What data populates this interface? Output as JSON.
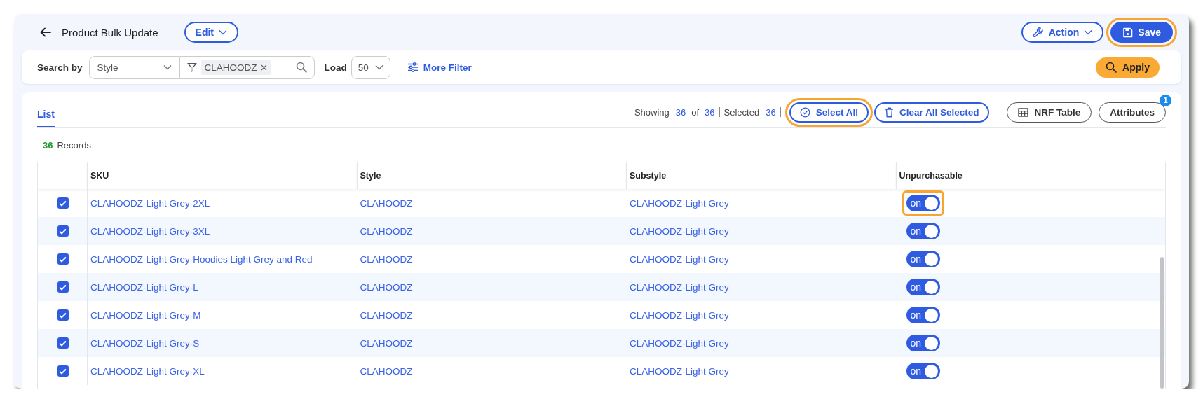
{
  "header": {
    "title": "Product Bulk Update",
    "edit_button": "Edit",
    "action_button": "Action",
    "save_button": {
      "label": "Save",
      "highlighted": true
    }
  },
  "filter_bar": {
    "search_by_label": "Search by",
    "search_by_value": "Style",
    "filter_chip": "CLAHOODZ",
    "load_label": "Load",
    "load_value": "50",
    "more_filter": "More Filter",
    "apply_button": "Apply"
  },
  "list": {
    "tabs": [
      {
        "label": "List",
        "selected": true
      }
    ],
    "records_count": "36",
    "records_label": "Records",
    "summary": {
      "showing_label": "Showing",
      "showing": "36",
      "of_label": "of",
      "total": "36",
      "selected_label": "Selected",
      "selected": "36"
    },
    "select_all": {
      "label": "Select All",
      "highlighted": true
    },
    "clear_all": "Clear All Selected",
    "nrf_table": "NRF Table",
    "attributes": {
      "label": "Attributes",
      "badge": "1"
    }
  },
  "table": {
    "columns": [
      "SKU",
      "Style",
      "Substyle",
      "Unpurchasable"
    ],
    "rows": [
      {
        "checked": true,
        "sku": "CLAHOODZ-Light Grey-2XL",
        "style": "CLAHOODZ",
        "substyle": "CLAHOODZ-Light Grey",
        "unpurchasable": {
          "label": "on",
          "on": true,
          "highlighted": true
        }
      },
      {
        "checked": true,
        "sku": "CLAHOODZ-Light Grey-3XL",
        "style": "CLAHOODZ",
        "substyle": "CLAHOODZ-Light Grey",
        "unpurchasable": {
          "label": "on",
          "on": true,
          "highlighted": false
        }
      },
      {
        "checked": true,
        "sku": "CLAHOODZ-Light Grey-Hoodies Light Grey and Red",
        "style": "CLAHOODZ",
        "substyle": "CLAHOODZ-Light Grey",
        "unpurchasable": {
          "label": "on",
          "on": true,
          "highlighted": false
        }
      },
      {
        "checked": true,
        "sku": "CLAHOODZ-Light Grey-L",
        "style": "CLAHOODZ",
        "substyle": "CLAHOODZ-Light Grey",
        "unpurchasable": {
          "label": "on",
          "on": true,
          "highlighted": false
        }
      },
      {
        "checked": true,
        "sku": "CLAHOODZ-Light Grey-M",
        "style": "CLAHOODZ",
        "substyle": "CLAHOODZ-Light Grey",
        "unpurchasable": {
          "label": "on",
          "on": true,
          "highlighted": false
        }
      },
      {
        "checked": true,
        "sku": "CLAHOODZ-Light Grey-S",
        "style": "CLAHOODZ",
        "substyle": "CLAHOODZ-Light Grey",
        "unpurchasable": {
          "label": "on",
          "on": true,
          "highlighted": false
        }
      },
      {
        "checked": true,
        "sku": "CLAHOODZ-Light Grey-XL",
        "style": "CLAHOODZ",
        "substyle": "CLAHOODZ-Light Grey",
        "unpurchasable": {
          "label": "on",
          "on": true,
          "highlighted": false
        }
      }
    ]
  }
}
